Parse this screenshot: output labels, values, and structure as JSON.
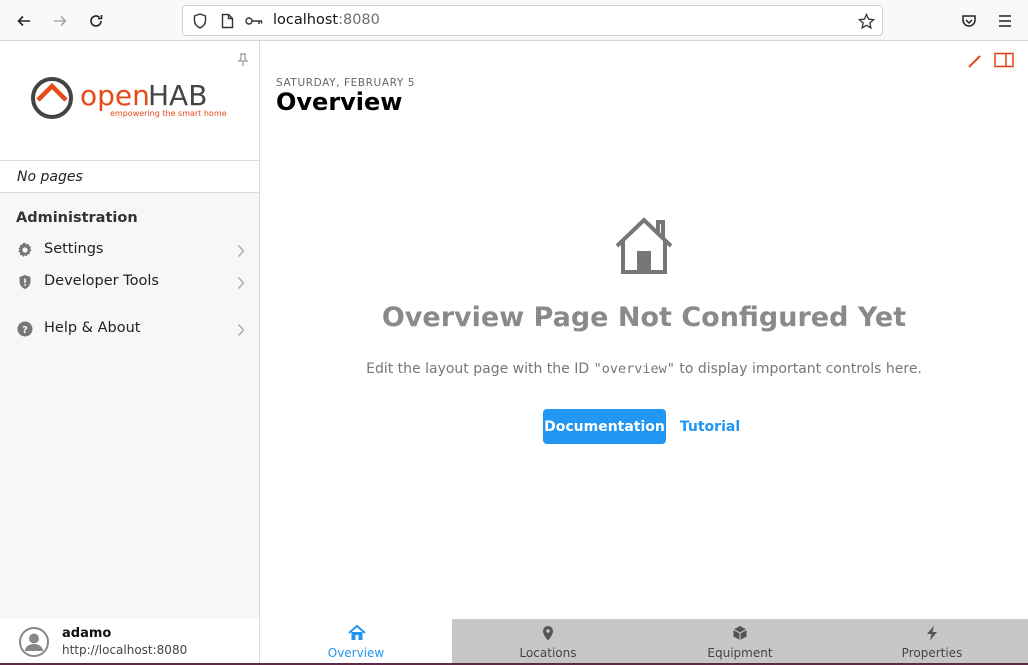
{
  "browser": {
    "url_host": "localhost",
    "url_port": ":8080"
  },
  "sidebar": {
    "logo_text_open": "open",
    "logo_text_hab": "HAB",
    "logo_tagline": "empowering the smart home",
    "no_pages": "No pages",
    "section_title": "Administration",
    "items": [
      {
        "label": "Settings",
        "icon": "gear-icon"
      },
      {
        "label": "Developer Tools",
        "icon": "shield-icon"
      },
      {
        "label": "Help & About",
        "icon": "question-circle-icon"
      }
    ]
  },
  "main": {
    "date": "SATURDAY, FEBRUARY 5",
    "title": "Overview",
    "empty_title": "Overview Page Not Configured Yet",
    "empty_text_before": "Edit the layout page with the ID ",
    "empty_text_code": "\"overview\"",
    "empty_text_after": " to display important controls here.",
    "doc_button": "Documentation",
    "tutorial_button": "Tutorial"
  },
  "user": {
    "name": "adamo",
    "url": "http://localhost:8080"
  },
  "tabs": [
    {
      "label": "Overview",
      "icon": "home-icon",
      "active": true
    },
    {
      "label": "Locations",
      "icon": "map-pin-icon",
      "active": false
    },
    {
      "label": "Equipment",
      "icon": "cube-icon",
      "active": false
    },
    {
      "label": "Properties",
      "icon": "bolt-icon",
      "active": false
    }
  ],
  "colors": {
    "accent": "#2196f3",
    "brand_orange": "#e64a19",
    "tabbar_bg": "#c7c7c7"
  }
}
